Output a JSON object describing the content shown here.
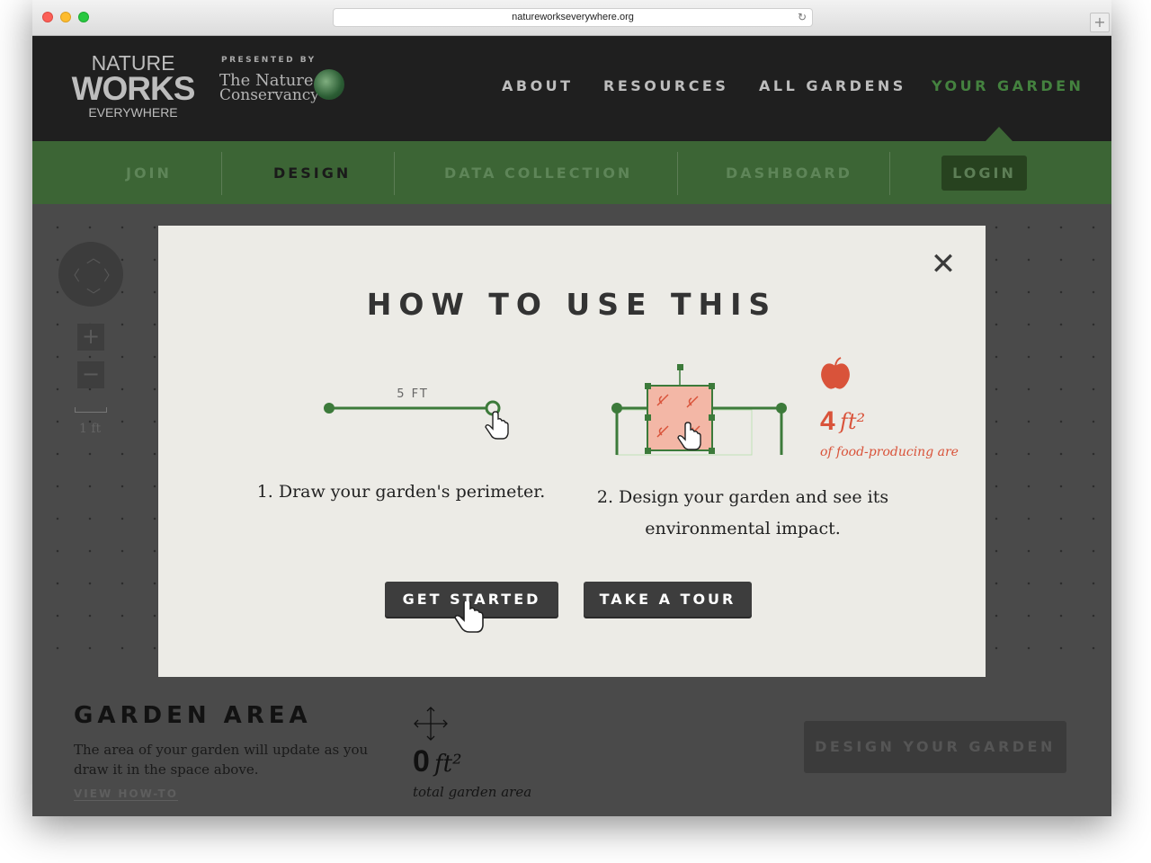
{
  "browser": {
    "url": "natureworkseverywhere.org"
  },
  "logo": {
    "line1": "NATURE",
    "line2": "WORKS",
    "line3": "EVERYWHERE"
  },
  "partner": {
    "presented": "PRESENTED BY",
    "name_a": "The Nature",
    "name_b": "Conservancy"
  },
  "topnav": [
    {
      "label": "ABOUT"
    },
    {
      "label": "RESOURCES"
    },
    {
      "label": "ALL GARDENS"
    },
    {
      "label": "YOUR GARDEN",
      "active": true
    }
  ],
  "subnav": [
    {
      "label": "JOIN"
    },
    {
      "label": "DESIGN",
      "current": true
    },
    {
      "label": "DATA COLLECTION"
    },
    {
      "label": "DASHBOARD"
    }
  ],
  "login_label": "LOGIN",
  "map_controls": {
    "zoom_in": "+",
    "zoom_out": "−",
    "scale_label": "1 ft"
  },
  "modal": {
    "title": "HOW TO USE THIS",
    "close": "✕",
    "illustration1": {
      "measure": "5 FT"
    },
    "illustration2": {
      "area_value": "4",
      "area_unit": "ft²",
      "area_caption": "of food-producing area"
    },
    "step1": "1. Draw your garden's perimeter.",
    "step2": "2. Design your garden and see its environmental impact.",
    "get_started": "GET STARTED",
    "take_tour": "TAKE A TOUR"
  },
  "garden_area": {
    "title": "GARDEN AREA",
    "description": "The area of your garden will update as you draw it in the space above.",
    "view_howto": "VIEW HOW-TO",
    "value": "0",
    "unit": "ft²",
    "value_label": "total garden area",
    "design_button": "DESIGN YOUR GARDEN"
  },
  "colors": {
    "brand_green": "#3c6535",
    "accent_red": "#d9533a",
    "dark": "#1f1f1f"
  }
}
